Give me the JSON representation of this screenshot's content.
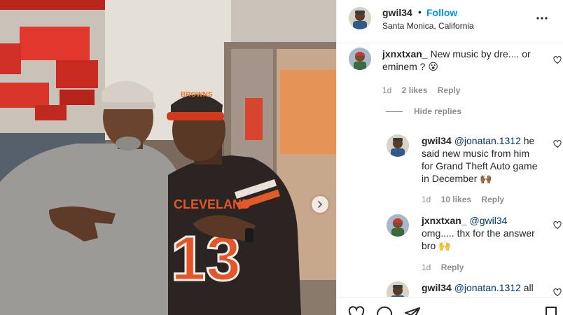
{
  "post": {
    "username": "gwil34",
    "separator": "•",
    "follow_label": "Follow",
    "location": "Santa Monica, California"
  },
  "photo": {
    "jersey_text": "CLEVELAND",
    "jersey_number": "13",
    "hat_text": "BROWNS"
  },
  "comments": [
    {
      "username": "jxnxtxan_",
      "text": "New music by dre.... or eminem ? 😮",
      "time": "1d",
      "likes": "2 likes",
      "reply_label": "Reply"
    }
  ],
  "hide_replies_label": "Hide replies",
  "replies": [
    {
      "username": "gwil34",
      "mention": "@jonatan.1312",
      "text": " he said new music from him for Grand Theft Auto game in December 🙌🏾",
      "time": "1d",
      "likes": "10 likes",
      "reply_label": "Reply"
    },
    {
      "username": "jxnxtxan_",
      "mention": "@gwil34",
      "text": "omg..... thx for the answer bro 🙌",
      "time": "1d",
      "reply_label": "Reply"
    },
    {
      "username": "gwil34",
      "mention": "@jonatan.1312",
      "text": " all"
    }
  ],
  "icons": {
    "like": "heart-icon",
    "comment": "comment-icon",
    "share": "share-icon",
    "save": "bookmark-icon",
    "more": "more-icon",
    "next": "chevron-right-icon"
  },
  "colors": {
    "follow": "#0095f6",
    "mention": "#00376b",
    "meta": "#8e8e8e"
  }
}
